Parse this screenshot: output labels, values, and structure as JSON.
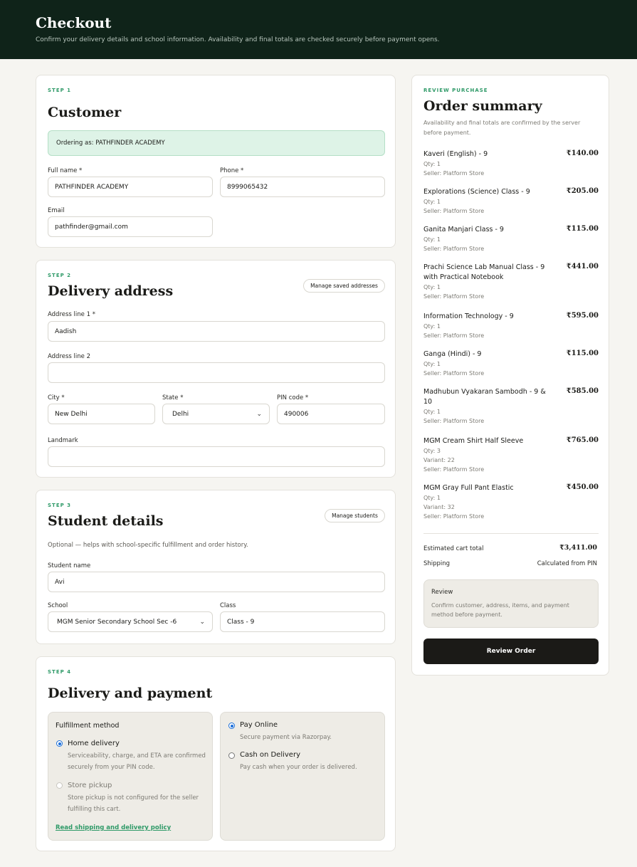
{
  "header": {
    "title": "Checkout",
    "subtitle": "Confirm your delivery details and school information. Availability and final totals are checked securely before payment opens."
  },
  "customer": {
    "step": "STEP 1",
    "title": "Customer",
    "notice": "Ordering as: PATHFINDER ACADEMY",
    "full_name_label": "Full name *",
    "full_name_value": "PATHFINDER ACADEMY",
    "phone_label": "Phone *",
    "phone_value": "8999065432",
    "email_label": "Email",
    "email_value": "pathfinder@gmail.com"
  },
  "address": {
    "step": "STEP 2",
    "title": "Delivery address",
    "manage_label": "Manage saved addresses",
    "line1_label": "Address line 1 *",
    "line1_value": "Aadish",
    "line2_label": "Address line 2",
    "line2_value": "",
    "city_label": "City *",
    "city_value": "New Delhi",
    "state_label": "State *",
    "state_value": "Delhi",
    "pin_label": "PIN code *",
    "pin_value": "490006",
    "landmark_label": "Landmark",
    "landmark_value": ""
  },
  "student": {
    "step": "STEP 3",
    "title": "Student details",
    "manage_label": "Manage students",
    "hint": "Optional — helps with school-specific fulfillment and order history.",
    "name_label": "Student name",
    "name_value": "Avi",
    "school_label": "School",
    "school_value": "MGM Senior Secondary School Sec -6",
    "class_label": "Class",
    "class_value": "Class - 9"
  },
  "delivery": {
    "step": "STEP 4",
    "title": "Delivery and payment",
    "fulfillment_title": "Fulfillment method",
    "home_title": "Home delivery",
    "home_desc_1": "Serviceability, charge, and ETA are confirmed",
    "home_desc_2": "securely from your PIN code.",
    "pickup_title": "Store pickup",
    "pickup_desc_1": "Store pickup is not configured for the seller",
    "pickup_desc_2": "fulfilling this cart.",
    "policy_link": "Read shipping and delivery policy",
    "pay_online_title": "Pay Online",
    "pay_online_desc": "Secure payment via Razorpay.",
    "cod_title": "Cash on Delivery",
    "cod_desc": "Pay cash when your order is delivered."
  },
  "summary": {
    "eyebrow": "REVIEW PURCHASE",
    "title": "Order summary",
    "desc_1": "Availability and final totals are confirmed by the server",
    "desc_2": "before payment.",
    "items": [
      {
        "name": "Kaveri (English) - 9",
        "price": "₹140.00",
        "meta": [
          "Qty: 1",
          "Seller: Platform Store"
        ]
      },
      {
        "name": "Explorations (Science) Class - 9",
        "price": "₹205.00",
        "meta": [
          "Qty: 1",
          "Seller: Platform Store"
        ]
      },
      {
        "name": "Ganita Manjari Class - 9",
        "price": "₹115.00",
        "meta": [
          "Qty: 1",
          "Seller: Platform Store"
        ]
      },
      {
        "name": "Prachi Science Lab Manual Class - 9 with Practical Notebook",
        "price": "₹441.00",
        "meta": [
          "Qty: 1",
          "Seller: Platform Store"
        ]
      },
      {
        "name": "Information Technology - 9",
        "price": "₹595.00",
        "meta": [
          "Qty: 1",
          "Seller: Platform Store"
        ]
      },
      {
        "name": "Ganga (Hindi) - 9",
        "price": "₹115.00",
        "meta": [
          "Qty: 1",
          "Seller: Platform Store"
        ]
      },
      {
        "name": "Madhubun Vyakaran Sambodh - 9 & 10",
        "price": "₹585.00",
        "meta": [
          "Qty: 1",
          "Seller: Platform Store"
        ]
      },
      {
        "name": "MGM Cream Shirt Half Sleeve",
        "price": "₹765.00",
        "meta": [
          "Qty: 3",
          "Variant: 22",
          "Seller: Platform Store"
        ]
      },
      {
        "name": "MGM Gray Full Pant Elastic",
        "price": "₹450.00",
        "meta": [
          "Qty: 1",
          "Variant: 32",
          "Seller: Platform Store"
        ]
      }
    ],
    "total_label": "Estimated cart total",
    "total_value": "₹3,411.00",
    "shipping_label": "Shipping",
    "shipping_value": "Calculated from PIN",
    "review_title": "Review",
    "review_desc_1": "Confirm customer, address, items, and payment",
    "review_desc_2": "method before payment.",
    "button_label": "Review Order"
  }
}
